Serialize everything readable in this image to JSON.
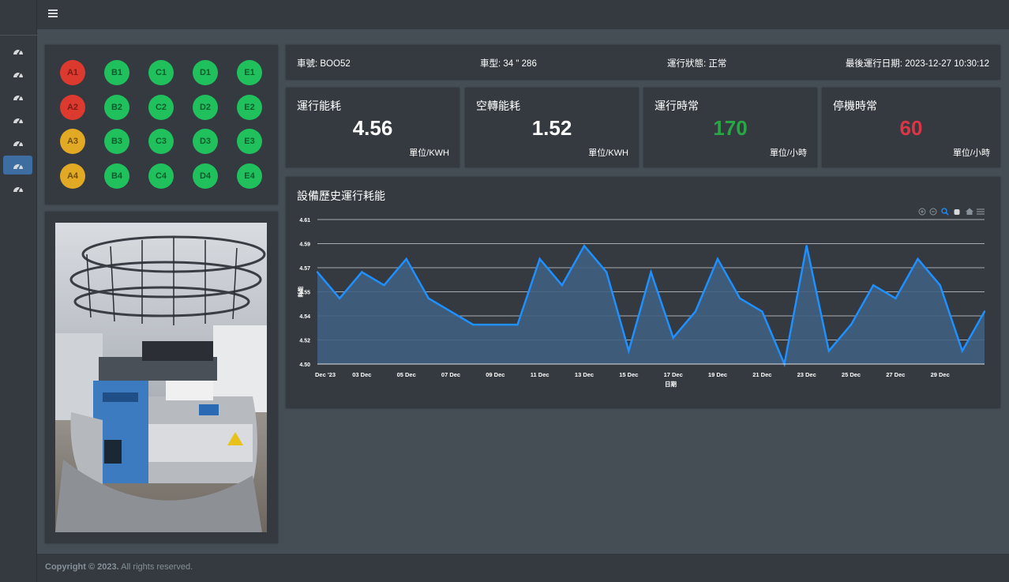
{
  "sidebar": {
    "items": [
      {
        "icon": "speedometer-icon",
        "active": false
      },
      {
        "icon": "speedometer-icon",
        "active": false
      },
      {
        "icon": "speedometer-icon",
        "active": false
      },
      {
        "icon": "speedometer-icon",
        "active": false
      },
      {
        "icon": "speedometer-icon",
        "active": false
      },
      {
        "icon": "speedometer-icon",
        "active": true
      },
      {
        "icon": "speedometer-icon",
        "active": false
      }
    ]
  },
  "topbar": {
    "menu_icon": "hamburger-icon"
  },
  "machine_grid": {
    "rows": [
      [
        {
          "label": "A1",
          "status": "red"
        },
        {
          "label": "B1",
          "status": "green"
        },
        {
          "label": "C1",
          "status": "green"
        },
        {
          "label": "D1",
          "status": "green"
        },
        {
          "label": "E1",
          "status": "green"
        }
      ],
      [
        {
          "label": "A2",
          "status": "red"
        },
        {
          "label": "B2",
          "status": "green"
        },
        {
          "label": "C2",
          "status": "green"
        },
        {
          "label": "D2",
          "status": "green"
        },
        {
          "label": "E2",
          "status": "green"
        }
      ],
      [
        {
          "label": "A3",
          "status": "yellow"
        },
        {
          "label": "B3",
          "status": "green"
        },
        {
          "label": "C3",
          "status": "green"
        },
        {
          "label": "D3",
          "status": "green"
        },
        {
          "label": "E3",
          "status": "green"
        }
      ],
      [
        {
          "label": "A4",
          "status": "yellow"
        },
        {
          "label": "B4",
          "status": "green"
        },
        {
          "label": "C4",
          "status": "green"
        },
        {
          "label": "D4",
          "status": "green"
        },
        {
          "label": "E4",
          "status": "green"
        }
      ]
    ]
  },
  "info": {
    "car_no": "車號: BOO52",
    "model": "車型: 34 \" 286",
    "status": "運行狀態: 正常",
    "last_run": "最後運行日期: 2023-12-27 10:30:12"
  },
  "kpis": [
    {
      "title": "運行能耗",
      "value": "4.56",
      "unit": "單位/KWH",
      "color": "#ffffff"
    },
    {
      "title": "空轉能耗",
      "value": "1.52",
      "unit": "單位/KWH",
      "color": "#ffffff"
    },
    {
      "title": "運行時常",
      "value": "170",
      "unit": "單位/小時",
      "color": "#28a745"
    },
    {
      "title": "停機時常",
      "value": "60",
      "unit": "單位/小時",
      "color": "#dc3545"
    }
  ],
  "chart_title": "設備歷史運行耗能",
  "chart_toolbar": [
    "zoom-in-icon",
    "zoom-out-icon",
    "magnifier-icon",
    "pan-hand-icon",
    "home-icon",
    "menu-icon"
  ],
  "chart_data": {
    "type": "area",
    "xlabel": "日期",
    "ylabel": "耗能",
    "ylim": [
      4.5,
      4.61
    ],
    "yticks": [
      "4.50",
      "4.52",
      "4.54",
      "4.55",
      "4.57",
      "4.59",
      "4.61"
    ],
    "xticks": [
      "Dec '23",
      "03 Dec",
      "05 Dec",
      "07 Dec",
      "09 Dec",
      "11 Dec",
      "13 Dec",
      "15 Dec",
      "17 Dec",
      "19 Dec",
      "21 Dec",
      "23 Dec",
      "25 Dec",
      "27 Dec",
      "29 Dec"
    ],
    "x": [
      "2023-12-01",
      "2023-12-02",
      "2023-12-03",
      "2023-12-04",
      "2023-12-05",
      "2023-12-06",
      "2023-12-07",
      "2023-12-08",
      "2023-12-09",
      "2023-12-10",
      "2023-12-11",
      "2023-12-12",
      "2023-12-13",
      "2023-12-14",
      "2023-12-15",
      "2023-12-16",
      "2023-12-17",
      "2023-12-18",
      "2023-12-19",
      "2023-12-20",
      "2023-12-21",
      "2023-12-22",
      "2023-12-23",
      "2023-12-24",
      "2023-12-25",
      "2023-12-26",
      "2023-12-27",
      "2023-12-28",
      "2023-12-29",
      "2023-12-30",
      "2023-12-31"
    ],
    "values": [
      4.57,
      4.55,
      4.57,
      4.56,
      4.58,
      4.55,
      4.54,
      4.53,
      4.53,
      4.53,
      4.58,
      4.56,
      4.59,
      4.57,
      4.51,
      4.57,
      4.52,
      4.54,
      4.58,
      4.55,
      4.54,
      4.5,
      4.59,
      4.51,
      4.53,
      4.56,
      4.55,
      4.58,
      4.56,
      4.51,
      4.54
    ],
    "grid": true,
    "line_color": "#1e90ff",
    "fill_color": "#3f5f7f"
  },
  "footer": {
    "copyright": "Copyright © 2023.",
    "rights": " All rights reserved."
  }
}
